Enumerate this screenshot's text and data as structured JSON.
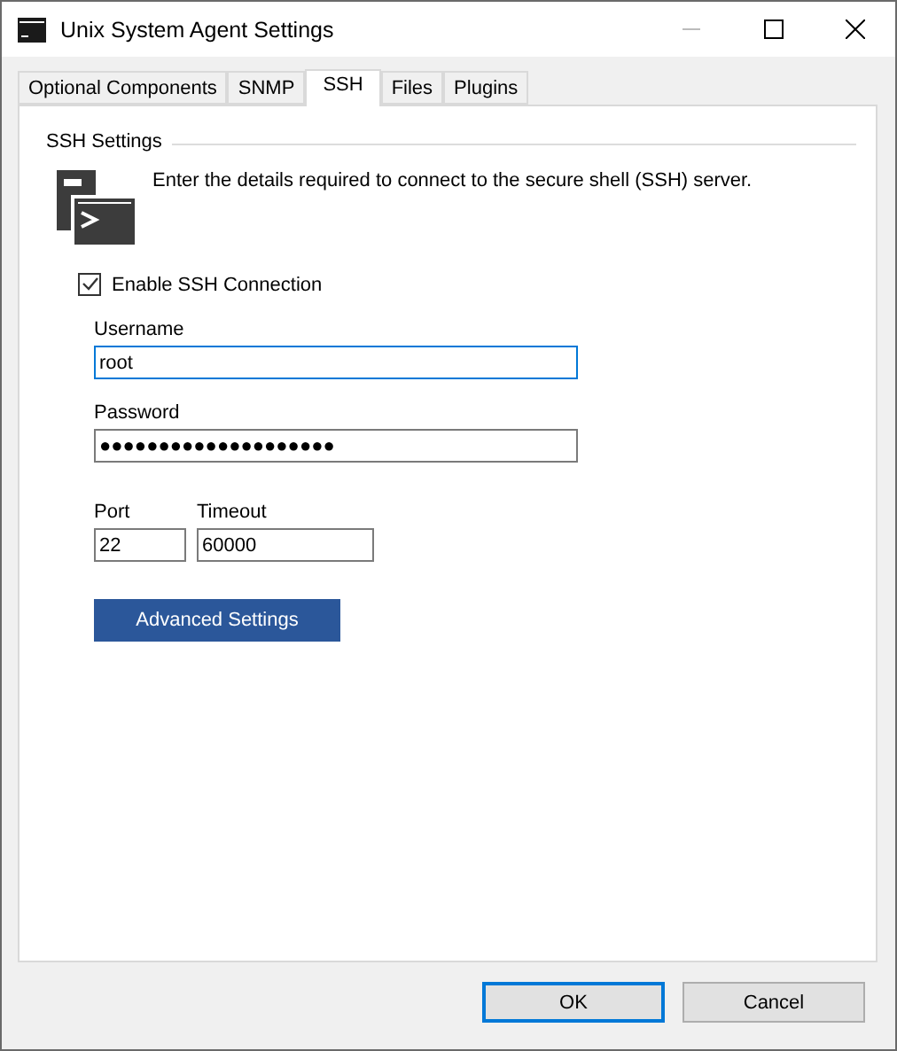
{
  "window": {
    "title": "Unix System Agent Settings"
  },
  "tabs": [
    {
      "label": "Optional Components",
      "selected": false
    },
    {
      "label": "SNMP",
      "selected": false
    },
    {
      "label": "SSH",
      "selected": true
    },
    {
      "label": "Files",
      "selected": false
    },
    {
      "label": "Plugins",
      "selected": false
    }
  ],
  "group": {
    "title": "SSH Settings",
    "description": "Enter the details required to connect to the secure shell (SSH) server."
  },
  "enable": {
    "label": "Enable SSH Connection",
    "checked": true
  },
  "username": {
    "label": "Username",
    "value": "root",
    "focused": true
  },
  "password": {
    "label": "Password",
    "value": "●●●●●●●●●●●●●●●●●●●●",
    "focused": false
  },
  "port": {
    "label": "Port",
    "value": "22",
    "focused": false
  },
  "timeout": {
    "label": "Timeout",
    "value": "60000",
    "focused": false
  },
  "advanced_button": "Advanced Settings",
  "buttons": [
    {
      "label": "OK",
      "default": true
    },
    {
      "label": "Cancel",
      "default": false
    }
  ]
}
